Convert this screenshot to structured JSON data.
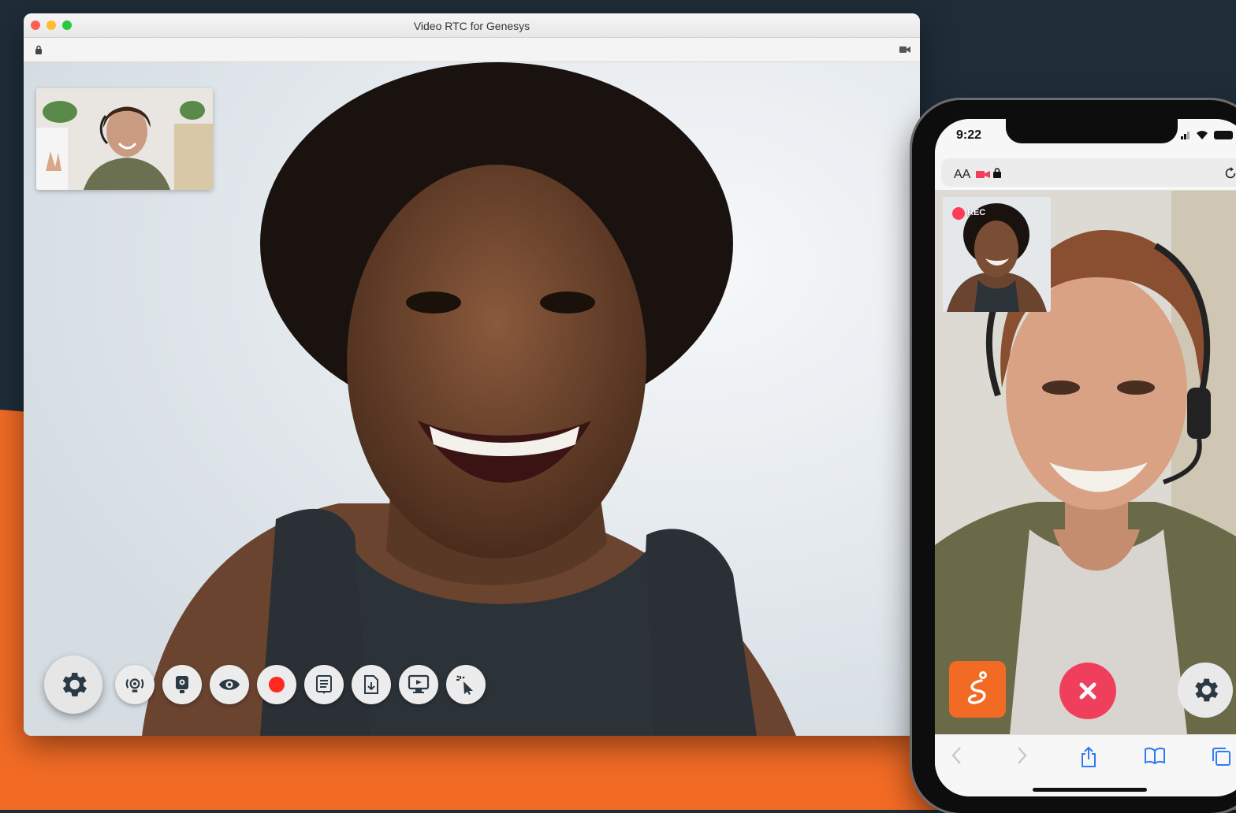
{
  "window": {
    "title": "Video RTC for Genesys"
  },
  "desktop_toolbar": {
    "buttons": [
      {
        "name": "settings",
        "icon": "gear-icon"
      },
      {
        "name": "switch-camera",
        "icon": "camera-switch-icon"
      },
      {
        "name": "webcam",
        "icon": "webcam-icon"
      },
      {
        "name": "view",
        "icon": "eye-icon"
      },
      {
        "name": "record",
        "icon": "record-icon",
        "color": "#ff2a1f"
      },
      {
        "name": "notes",
        "icon": "document-icon"
      },
      {
        "name": "download",
        "icon": "file-download-icon"
      },
      {
        "name": "screen-share",
        "icon": "monitor-icon"
      },
      {
        "name": "pointer",
        "icon": "cursor-click-icon"
      }
    ]
  },
  "phone": {
    "status": {
      "time": "9:22"
    },
    "urlbar": {
      "text_size_label": "AA"
    },
    "pip": {
      "rec_label": "REC"
    },
    "colors": {
      "brand_orange": "#f26b25",
      "end_call_red": "#ef3f5d",
      "rec_red": "#ff3b5c"
    }
  },
  "colors": {
    "background_navy": "#1f2d39",
    "background_orange": "#f26b25"
  }
}
